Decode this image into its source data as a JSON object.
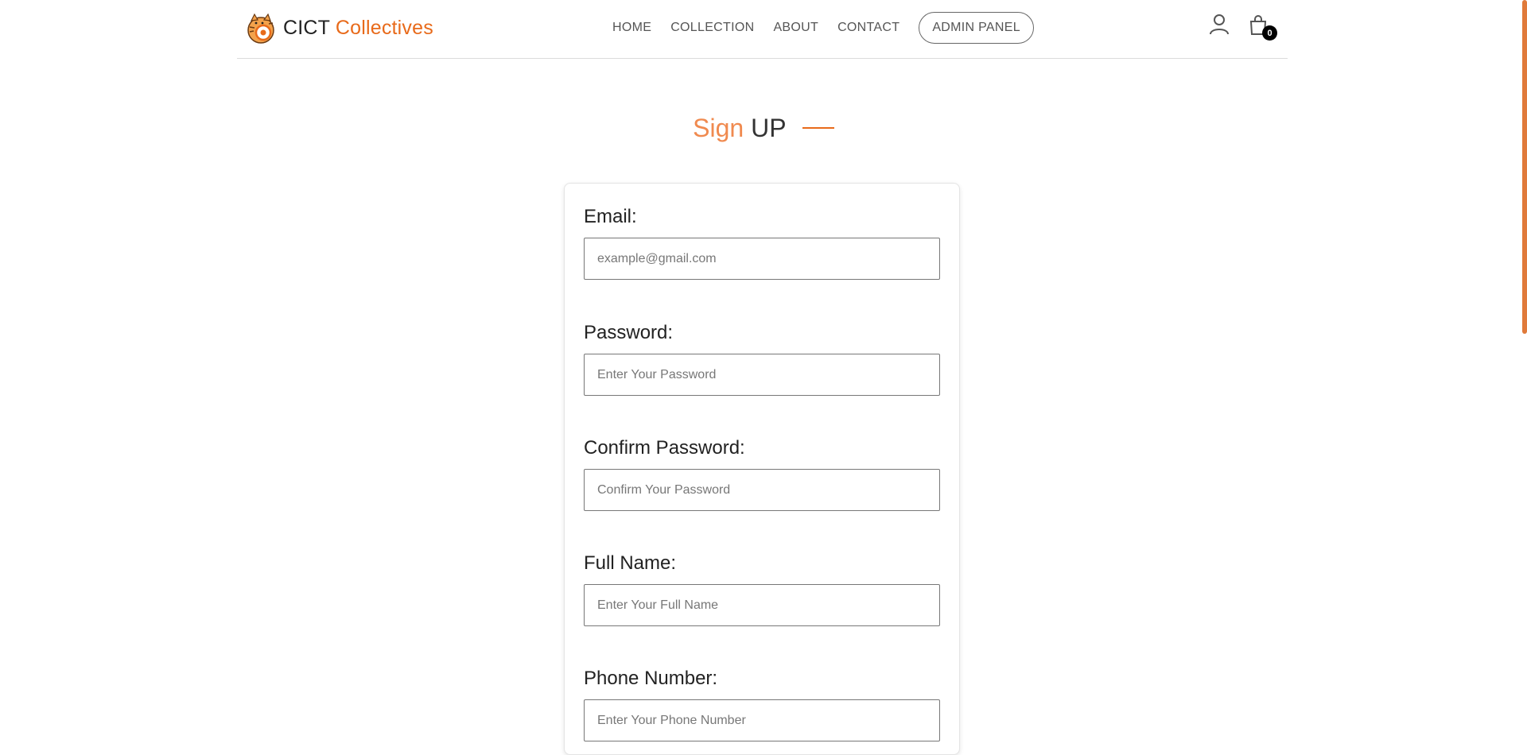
{
  "header": {
    "brand": {
      "prefix": "CICT",
      "accent": "Collectives"
    },
    "nav": [
      "HOME",
      "COLLECTION",
      "ABOUT",
      "CONTACT"
    ],
    "admin_label": "ADMIN PANEL",
    "cart_count": "0"
  },
  "page": {
    "title_accent": "Sign",
    "title_rest": "UP"
  },
  "form": {
    "fields": [
      {
        "label": "Email:",
        "placeholder": "example@gmail.com"
      },
      {
        "label": "Password:",
        "placeholder": "Enter Your Password"
      },
      {
        "label": "Confirm Password:",
        "placeholder": "Confirm Your Password"
      },
      {
        "label": "Full Name:",
        "placeholder": "Enter Your Full Name"
      },
      {
        "label": "Phone Number:",
        "placeholder": "Enter Your Phone Number"
      }
    ]
  },
  "colors": {
    "accent": "#e86a1a",
    "title_accent": "#f08a4f",
    "border": "#777777"
  }
}
